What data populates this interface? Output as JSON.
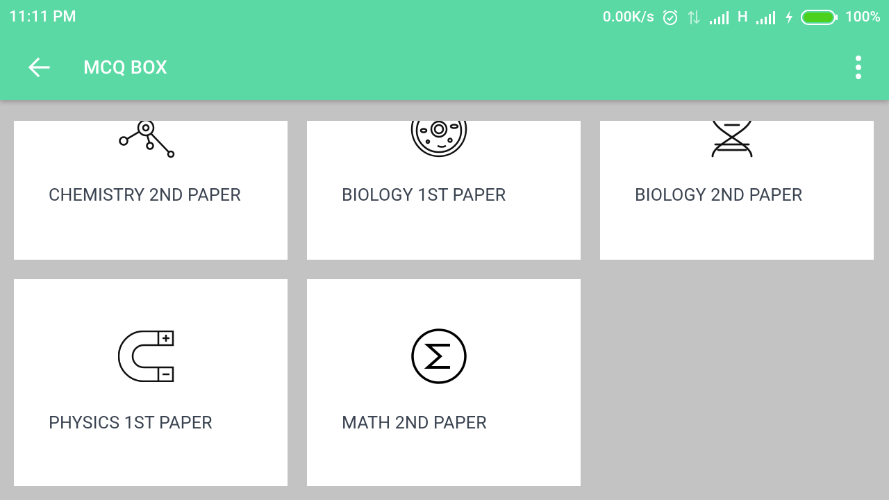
{
  "status_bar": {
    "time": "11:11 PM",
    "network_speed": "0.00K/s",
    "network_type": "H",
    "battery_percent": "100%",
    "icons": [
      "alarm-icon",
      "data-arrows-icon",
      "signal-icon",
      "signal-icon",
      "charging-icon",
      "battery-icon"
    ]
  },
  "toolbar": {
    "title": "MCQ BOX",
    "back_icon": "arrow-left-icon",
    "menu_icon": "more-vert-icon"
  },
  "subjects": [
    {
      "label": "CHEMISTRY 2ND PAPER",
      "icon": "molecule-icon"
    },
    {
      "label": "BIOLOGY 1ST PAPER",
      "icon": "cell-icon"
    },
    {
      "label": "BIOLOGY 2ND PAPER",
      "icon": "dna-icon"
    },
    {
      "label": "PHYSICS 1ST PAPER",
      "icon": "magnet-icon"
    },
    {
      "label": "MATH 2ND PAPER",
      "icon": "sigma-icon"
    }
  ],
  "colors": {
    "primary": "#5ad9a4",
    "background": "#c3c3c3",
    "card": "#ffffff",
    "label_text": "#3a4350",
    "battery": "#4cd01e"
  }
}
